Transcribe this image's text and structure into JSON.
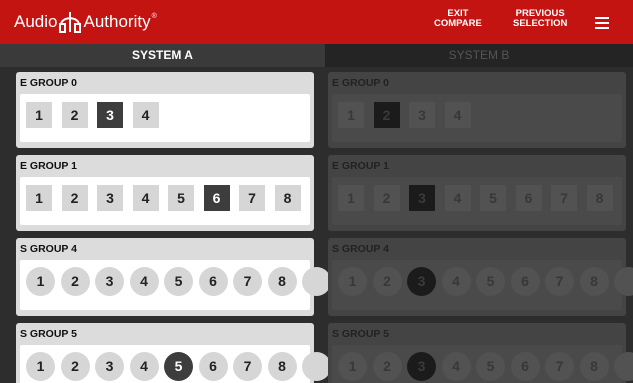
{
  "header": {
    "brand_left": "Audio",
    "brand_right": "Authority",
    "brand_mark": "®",
    "exit_compare_line1": "EXIT",
    "exit_compare_line2": "COMPARE",
    "previous_line1": "PREVIOUS",
    "previous_line2": "SELECTION",
    "menu_icon": "hamburger-icon"
  },
  "tabs": {
    "system_a": "SYSTEM A",
    "system_b": "SYSTEM B"
  },
  "system_a": {
    "groups": [
      {
        "name": "E GROUP 0",
        "shape": "square",
        "buttons": [
          "1",
          "2",
          "3",
          "4"
        ],
        "selected": "3"
      },
      {
        "name": "E GROUP 1",
        "shape": "square",
        "buttons": [
          "1",
          "2",
          "3",
          "4",
          "5",
          "6",
          "7",
          "8"
        ],
        "selected": "6"
      },
      {
        "name": "S GROUP 4",
        "shape": "circle",
        "buttons": [
          "1",
          "2",
          "3",
          "4",
          "5",
          "6",
          "7",
          "8"
        ],
        "selected": null
      },
      {
        "name": "S GROUP 5",
        "shape": "circle",
        "buttons": [
          "1",
          "2",
          "3",
          "4",
          "5",
          "6",
          "7",
          "8"
        ],
        "selected": "5"
      }
    ]
  },
  "system_b": {
    "groups": [
      {
        "name": "E GROUP 0",
        "shape": "square",
        "buttons": [
          "1",
          "2",
          "3",
          "4"
        ],
        "selected": "2"
      },
      {
        "name": "E GROUP 1",
        "shape": "square",
        "buttons": [
          "1",
          "2",
          "3",
          "4",
          "5",
          "6",
          "7",
          "8"
        ],
        "selected": "3"
      },
      {
        "name": "S GROUP 4",
        "shape": "circle",
        "buttons": [
          "1",
          "2",
          "3",
          "4",
          "5",
          "6",
          "7",
          "8"
        ],
        "selected": "3"
      },
      {
        "name": "S GROUP 5",
        "shape": "circle",
        "buttons": [
          "1",
          "2",
          "3",
          "4",
          "5",
          "6",
          "7",
          "8"
        ],
        "selected": "3"
      }
    ]
  },
  "colors": {
    "header_red": "#c41411",
    "selected_button": "#3d3d3d",
    "unselected_button": "#d6d6d6"
  }
}
